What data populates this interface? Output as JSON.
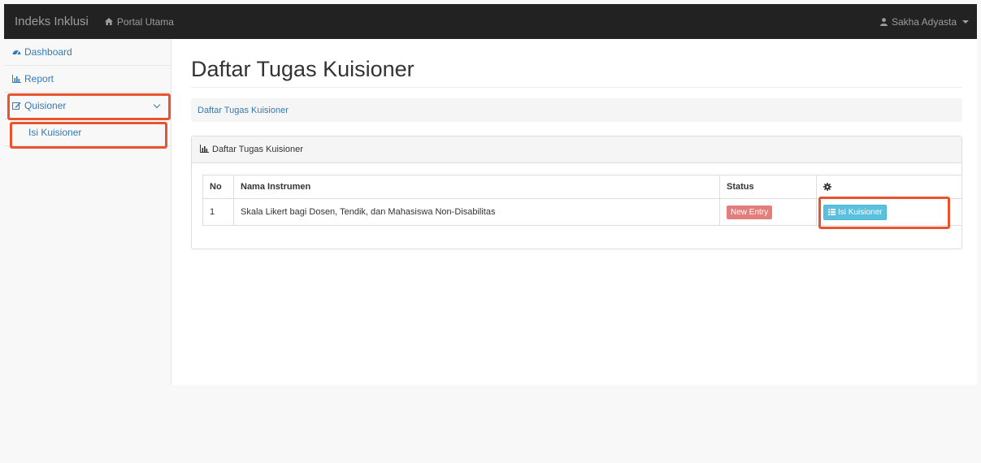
{
  "navbar": {
    "brand": "Indeks Inklusi",
    "portal_label": "Portal Utama",
    "user_name": "Sakha Adyasta"
  },
  "sidebar": {
    "items": [
      {
        "label": "Dashboard",
        "icon": "dashboard-icon"
      },
      {
        "label": "Report",
        "icon": "bar-chart-icon"
      },
      {
        "label": "Quisioner",
        "icon": "edit-icon"
      }
    ],
    "sub_items": [
      {
        "label": "Isi Kuisioner"
      }
    ]
  },
  "main": {
    "title": "Daftar Tugas Kuisioner",
    "breadcrumb": "Daftar Tugas Kuisioner",
    "panel_title": "Daftar Tugas Kuisioner",
    "table": {
      "headers": [
        "No",
        "Nama Instrumen",
        "Status"
      ],
      "header_action_icon": "gear-icon",
      "rows": [
        {
          "no": "1",
          "nama": "Skala Likert bagi Dosen, Tendik, dan Mahasiswa Non-Disabilitas",
          "status": "New Entry",
          "action_label": "Isi Kuisioner"
        }
      ]
    }
  },
  "colors": {
    "navbar_bg": "#222222",
    "link": "#337ab7",
    "highlight": "#e8542e",
    "status_new": "#d9534f",
    "info_button": "#5bc0de"
  }
}
